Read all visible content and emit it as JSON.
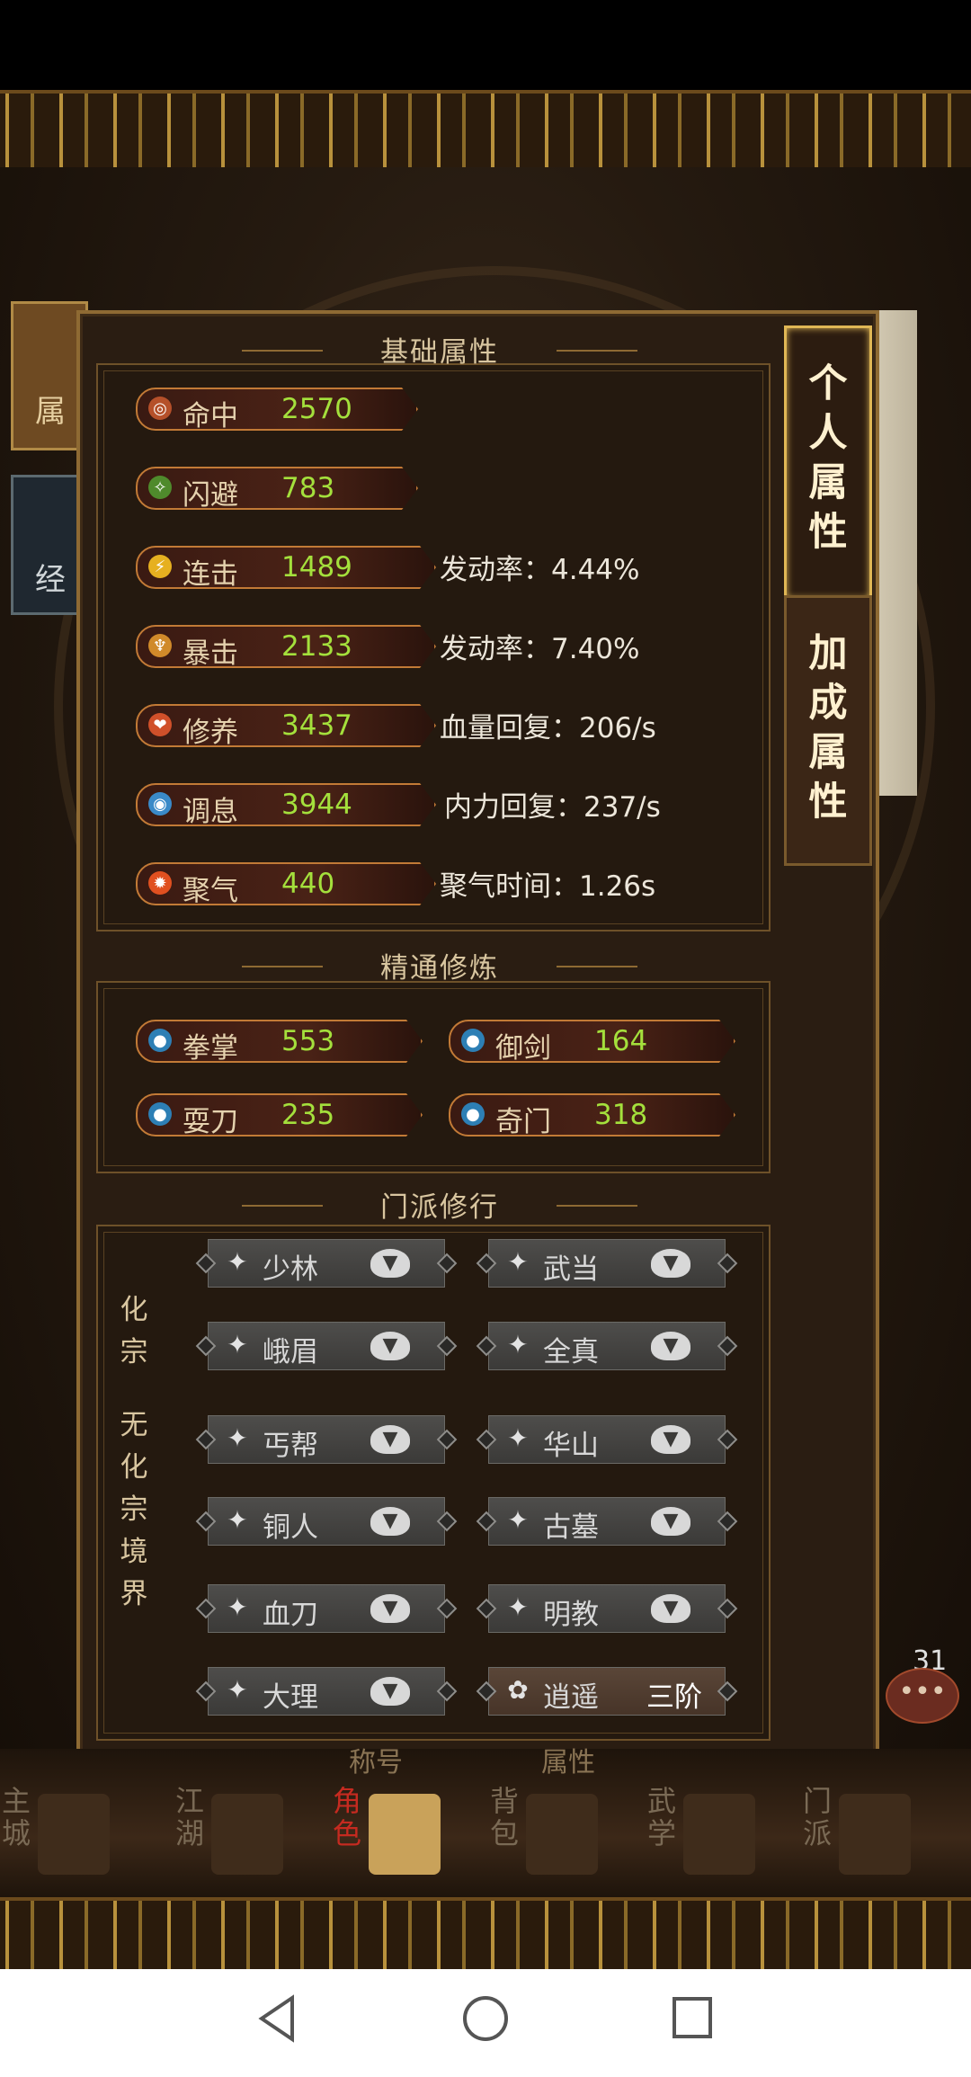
{
  "panel": {
    "section_basic": "基础属性",
    "section_mastery": "精通修炼",
    "section_sect": "门派修行"
  },
  "basic_stats": [
    {
      "label": "命中",
      "value": "2570",
      "extra": "",
      "icon": "target-icon",
      "icon_color": "#b5502a"
    },
    {
      "label": "闪避",
      "value": "783",
      "extra": "",
      "icon": "dodge-icon",
      "icon_color": "#4f8a2c"
    },
    {
      "label": "连击",
      "value": "1489",
      "extra": "发动率：4.44%",
      "icon": "lightning-icon",
      "icon_color": "#e6b020"
    },
    {
      "label": "暴击",
      "value": "2133",
      "extra": "发动率：7.40%",
      "icon": "crit-icon",
      "icon_color": "#d08a2a"
    },
    {
      "label": "修养",
      "value": "3437",
      "extra": "血量回复：206/s",
      "icon": "heart-icon",
      "icon_color": "#d0502a"
    },
    {
      "label": "调息",
      "value": "3944",
      "extra": "内力回复：237/s",
      "icon": "breath-icon",
      "icon_color": "#3a8ac8"
    },
    {
      "label": "聚气",
      "value": "440",
      "extra": "聚气时间：1.26s",
      "icon": "fire-icon",
      "icon_color": "#e05020"
    }
  ],
  "mastery": [
    {
      "label": "拳掌",
      "value": "553",
      "icon": "fist-icon"
    },
    {
      "label": "御剑",
      "value": "164",
      "icon": "sword-icon"
    },
    {
      "label": "耍刀",
      "value": "235",
      "icon": "blade-icon"
    },
    {
      "label": "奇门",
      "value": "318",
      "icon": "mystic-icon"
    }
  ],
  "sect_side": {
    "top": [
      "化",
      "宗"
    ],
    "bottom": [
      "无",
      "化",
      "宗",
      "境",
      "界"
    ]
  },
  "sects": [
    {
      "name": "少林",
      "icon": "shaolin-icon",
      "tier": ""
    },
    {
      "name": "武当",
      "icon": "wudang-icon",
      "tier": ""
    },
    {
      "name": "峨眉",
      "icon": "emei-icon",
      "tier": ""
    },
    {
      "name": "全真",
      "icon": "quanzhen-icon",
      "tier": ""
    },
    {
      "name": "丐帮",
      "icon": "gaibang-icon",
      "tier": ""
    },
    {
      "name": "华山",
      "icon": "huashan-icon",
      "tier": ""
    },
    {
      "name": "铜人",
      "icon": "tongren-icon",
      "tier": ""
    },
    {
      "name": "古墓",
      "icon": "gumu-icon",
      "tier": ""
    },
    {
      "name": "血刀",
      "icon": "xuedao-icon",
      "tier": ""
    },
    {
      "name": "明教",
      "icon": "mingjiao-icon",
      "tier": ""
    },
    {
      "name": "大理",
      "icon": "dali-icon",
      "tier": ""
    },
    {
      "name": "逍遥",
      "icon": "xiaoyao-icon",
      "tier": "三阶"
    }
  ],
  "tabs": [
    {
      "label": [
        "个",
        "人",
        "属",
        "性"
      ],
      "active": true
    },
    {
      "label": [
        "加",
        "成",
        "属",
        "性"
      ],
      "active": false
    }
  ],
  "background": {
    "left_banner_1": "属",
    "left_banner_2": "经"
  },
  "nav": {
    "items": [
      {
        "label": "主城",
        "active": false
      },
      {
        "label": "江湖",
        "active": false
      },
      {
        "label": "角色",
        "active": true
      },
      {
        "label": "背包",
        "active": false
      },
      {
        "label": "武学",
        "active": false
      },
      {
        "label": "门派",
        "active": false
      }
    ],
    "sub_left": "称号",
    "sub_right": "属性"
  },
  "chat": {
    "count": "31"
  },
  "colors": {
    "stat_value": "#a4e03c",
    "panel_border": "#8e6a33",
    "active_tab": "#e0b755"
  }
}
